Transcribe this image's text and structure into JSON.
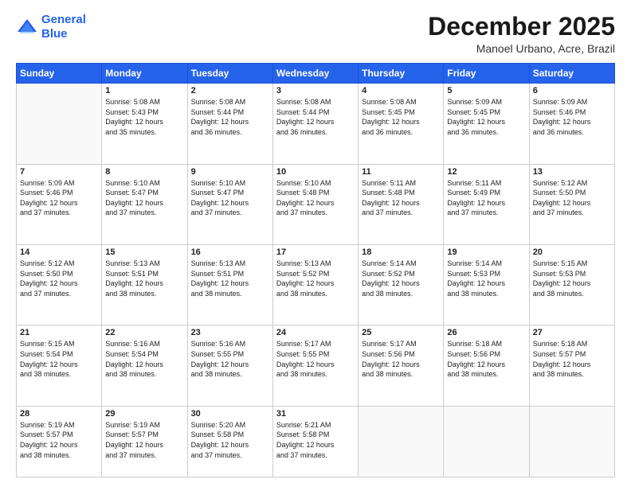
{
  "header": {
    "logo_line1": "General",
    "logo_line2": "Blue",
    "title": "December 2025",
    "subtitle": "Manoel Urbano, Acre, Brazil"
  },
  "calendar": {
    "days_of_week": [
      "Sunday",
      "Monday",
      "Tuesday",
      "Wednesday",
      "Thursday",
      "Friday",
      "Saturday"
    ],
    "weeks": [
      [
        {
          "day": "",
          "info": ""
        },
        {
          "day": "1",
          "info": "Sunrise: 5:08 AM\nSunset: 5:43 PM\nDaylight: 12 hours\nand 35 minutes."
        },
        {
          "day": "2",
          "info": "Sunrise: 5:08 AM\nSunset: 5:44 PM\nDaylight: 12 hours\nand 36 minutes."
        },
        {
          "day": "3",
          "info": "Sunrise: 5:08 AM\nSunset: 5:44 PM\nDaylight: 12 hours\nand 36 minutes."
        },
        {
          "day": "4",
          "info": "Sunrise: 5:08 AM\nSunset: 5:45 PM\nDaylight: 12 hours\nand 36 minutes."
        },
        {
          "day": "5",
          "info": "Sunrise: 5:09 AM\nSunset: 5:45 PM\nDaylight: 12 hours\nand 36 minutes."
        },
        {
          "day": "6",
          "info": "Sunrise: 5:09 AM\nSunset: 5:46 PM\nDaylight: 12 hours\nand 36 minutes."
        }
      ],
      [
        {
          "day": "7",
          "info": "Sunrise: 5:09 AM\nSunset: 5:46 PM\nDaylight: 12 hours\nand 37 minutes."
        },
        {
          "day": "8",
          "info": "Sunrise: 5:10 AM\nSunset: 5:47 PM\nDaylight: 12 hours\nand 37 minutes."
        },
        {
          "day": "9",
          "info": "Sunrise: 5:10 AM\nSunset: 5:47 PM\nDaylight: 12 hours\nand 37 minutes."
        },
        {
          "day": "10",
          "info": "Sunrise: 5:10 AM\nSunset: 5:48 PM\nDaylight: 12 hours\nand 37 minutes."
        },
        {
          "day": "11",
          "info": "Sunrise: 5:11 AM\nSunset: 5:48 PM\nDaylight: 12 hours\nand 37 minutes."
        },
        {
          "day": "12",
          "info": "Sunrise: 5:11 AM\nSunset: 5:49 PM\nDaylight: 12 hours\nand 37 minutes."
        },
        {
          "day": "13",
          "info": "Sunrise: 5:12 AM\nSunset: 5:50 PM\nDaylight: 12 hours\nand 37 minutes."
        }
      ],
      [
        {
          "day": "14",
          "info": "Sunrise: 5:12 AM\nSunset: 5:50 PM\nDaylight: 12 hours\nand 37 minutes."
        },
        {
          "day": "15",
          "info": "Sunrise: 5:13 AM\nSunset: 5:51 PM\nDaylight: 12 hours\nand 38 minutes."
        },
        {
          "day": "16",
          "info": "Sunrise: 5:13 AM\nSunset: 5:51 PM\nDaylight: 12 hours\nand 38 minutes."
        },
        {
          "day": "17",
          "info": "Sunrise: 5:13 AM\nSunset: 5:52 PM\nDaylight: 12 hours\nand 38 minutes."
        },
        {
          "day": "18",
          "info": "Sunrise: 5:14 AM\nSunset: 5:52 PM\nDaylight: 12 hours\nand 38 minutes."
        },
        {
          "day": "19",
          "info": "Sunrise: 5:14 AM\nSunset: 5:53 PM\nDaylight: 12 hours\nand 38 minutes."
        },
        {
          "day": "20",
          "info": "Sunrise: 5:15 AM\nSunset: 5:53 PM\nDaylight: 12 hours\nand 38 minutes."
        }
      ],
      [
        {
          "day": "21",
          "info": "Sunrise: 5:15 AM\nSunset: 5:54 PM\nDaylight: 12 hours\nand 38 minutes."
        },
        {
          "day": "22",
          "info": "Sunrise: 5:16 AM\nSunset: 5:54 PM\nDaylight: 12 hours\nand 38 minutes."
        },
        {
          "day": "23",
          "info": "Sunrise: 5:16 AM\nSunset: 5:55 PM\nDaylight: 12 hours\nand 38 minutes."
        },
        {
          "day": "24",
          "info": "Sunrise: 5:17 AM\nSunset: 5:55 PM\nDaylight: 12 hours\nand 38 minutes."
        },
        {
          "day": "25",
          "info": "Sunrise: 5:17 AM\nSunset: 5:56 PM\nDaylight: 12 hours\nand 38 minutes."
        },
        {
          "day": "26",
          "info": "Sunrise: 5:18 AM\nSunset: 5:56 PM\nDaylight: 12 hours\nand 38 minutes."
        },
        {
          "day": "27",
          "info": "Sunrise: 5:18 AM\nSunset: 5:57 PM\nDaylight: 12 hours\nand 38 minutes."
        }
      ],
      [
        {
          "day": "28",
          "info": "Sunrise: 5:19 AM\nSunset: 5:57 PM\nDaylight: 12 hours\nand 38 minutes."
        },
        {
          "day": "29",
          "info": "Sunrise: 5:19 AM\nSunset: 5:57 PM\nDaylight: 12 hours\nand 37 minutes."
        },
        {
          "day": "30",
          "info": "Sunrise: 5:20 AM\nSunset: 5:58 PM\nDaylight: 12 hours\nand 37 minutes."
        },
        {
          "day": "31",
          "info": "Sunrise: 5:21 AM\nSunset: 5:58 PM\nDaylight: 12 hours\nand 37 minutes."
        },
        {
          "day": "",
          "info": ""
        },
        {
          "day": "",
          "info": ""
        },
        {
          "day": "",
          "info": ""
        }
      ]
    ]
  }
}
